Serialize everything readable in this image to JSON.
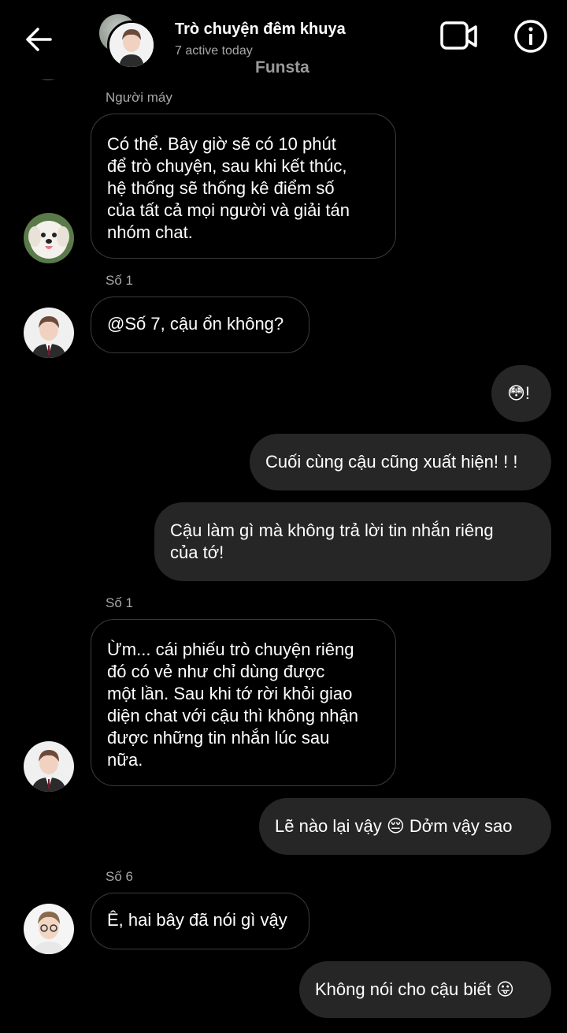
{
  "header": {
    "title": "Trò chuyện đêm khuya",
    "subtitle": "7 active today",
    "watermark": "Funsta"
  },
  "messages": [
    {
      "sender": "Người máy",
      "text": "Có thể. Bây giờ sẽ có 10 phút\nđể trò chuyện, sau khi kết thúc,\nhệ thống sẽ thống kê điểm số\ncủa tất cả mọi người và giải tán\nnhóm chat."
    },
    {
      "sender": "Số 1",
      "text": "@Số 7, cậu ổn không?"
    },
    {
      "text": "😳!"
    },
    {
      "text": "Cuối cùng cậu cũng xuất hiện! ! !"
    },
    {
      "text": "Cậu làm gì mà không trả lời tin nhắn riêng\ncủa tớ!"
    },
    {
      "sender": "Số 1",
      "text": "Ừm... cái phiếu trò chuyện riêng\nđó có vẻ như chỉ dùng được\nmột lần. Sau khi tớ rời khỏi giao\ndiện chat với cậu thì không nhận\nđược những tin nhắn lúc sau\nnữa."
    },
    {
      "text": "Lẽ nào lại vậy 😔 Dởm vậy sao"
    },
    {
      "sender": "Số 6",
      "text": "Ê, hai bây đã nói gì vậy"
    },
    {
      "text": "Không nói cho cậu biết 😛"
    }
  ],
  "colors": {
    "background": "#000000",
    "outgoing_bubble": "#262626",
    "incoming_border": "#3b3b3b",
    "secondary_text": "#a8a8a8"
  },
  "icons": [
    "back-arrow-icon",
    "video-call-icon",
    "info-icon"
  ]
}
